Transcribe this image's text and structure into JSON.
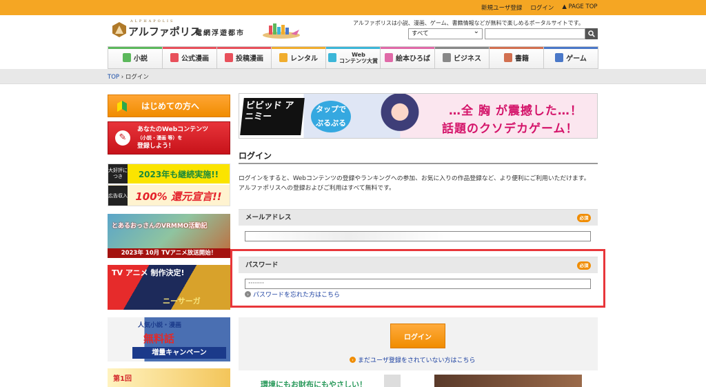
{
  "topbar": {
    "register": "新規ユーザ登録",
    "login": "ログイン",
    "pagetop": "▲ PAGE TOP"
  },
  "header": {
    "logo_small": "ALPHAPOLIS",
    "logo_text": "アルファポリス",
    "logo_sub": "電網浮遊都市",
    "tagline": "アルファポリスは小説、漫画、ゲーム、書籍情報などが無料で楽しめるポータルサイトです。",
    "search_select": "すべて",
    "search_placeholder": ""
  },
  "nav": [
    {
      "label": "小説",
      "color": "#5cb85c",
      "icon": "book-icon"
    },
    {
      "label": "公式漫画",
      "color": "#e8505b",
      "icon": "manga-icon"
    },
    {
      "label": "投稿漫画",
      "color": "#e8505b",
      "icon": "manga-icon"
    },
    {
      "label": "レンタル",
      "color": "#f0ad2e",
      "icon": "rental-icon"
    },
    {
      "label": "Web",
      "label2": "コンテンツ大賞",
      "color": "#3cb6d8",
      "icon": "trophy-icon"
    },
    {
      "label": "絵本ひろば",
      "color": "#e06aa8",
      "icon": "picturebook-icon"
    },
    {
      "label": "ビジネス",
      "color": "#888888",
      "icon": "chart-icon"
    },
    {
      "label": "書籍",
      "color": "#d27050",
      "icon": "open-book-icon"
    },
    {
      "label": "ゲーム",
      "color": "#4a78c8",
      "icon": "gamepad-icon"
    }
  ],
  "breadcrumb": {
    "top": "TOP",
    "sep": "›",
    "current": "ログイン"
  },
  "sidebar": {
    "first_button": "はじめての方へ",
    "register_l1": "あなたのWebコンテンツ",
    "register_l2": "（小説・漫画 等）を",
    "register_l3": "登録しよう！",
    "banner1_tag1": "大好評につき",
    "banner1_big1": "2023年も継続実施!!",
    "banner1_tag2": "広告収入",
    "banner1_big2": "100% 還元宣言!!",
    "banner2_title": "とあるおっさんのVRMMO活動記",
    "banner2_bottom": "2023年 10月 TVアニメ放送開始！",
    "banner3_title": "TV アニメ 制作決定!",
    "banner3_name": "ニーサーガ",
    "banner4_l1": "人気小説・漫画",
    "banner4_l2": "無料話",
    "banner4_l3": "増量キャンペーン",
    "banner5": "第1回"
  },
  "main": {
    "banner_left": "ビビッド アニミー",
    "banner_mid": "タップで ぷるぷる",
    "banner_right1": "…全 胸 が震撼した…！",
    "banner_right2": "話題のクソデカゲーム！",
    "title": "ログイン",
    "intro1": "ログインをすると、Webコンテンツの登録やランキングへの参加、お気に入りの作品登録など、より便利にご利用いただけます。",
    "intro2": "アルファポリスへの登録およびご利用はすべて無料です。",
    "email_label": "メールアドレス",
    "required": "必須",
    "email_value": "",
    "password_label": "パスワード",
    "password_value": "········",
    "forgot": "パスワードを忘れた方はこちら",
    "login_button": "ログイン",
    "not_registered": "まだユーザ登録をされていない方はこちら",
    "ad_text": "環境にもお財布にもやさしい！"
  },
  "colors": {
    "accent": "#f5a623",
    "highlight": "#e8363a",
    "link": "#1a3fa0"
  }
}
